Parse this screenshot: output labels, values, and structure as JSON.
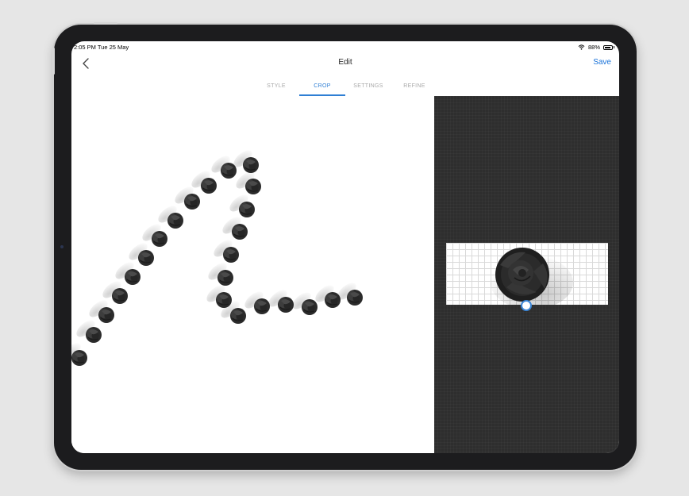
{
  "status_bar": {
    "time_date": "2:05 PM  Tue 25 May",
    "battery": "88%"
  },
  "nav": {
    "title": "Edit",
    "save_label": "Save"
  },
  "tabs": [
    {
      "label": "STYLE"
    },
    {
      "label": "CROP"
    },
    {
      "label": "SETTINGS"
    },
    {
      "label": "REFINE"
    }
  ],
  "active_tab": "CROP",
  "colors": {
    "accent": "#2f7fd4",
    "panel_background": "#2e2e2e",
    "rose": "#2a2a2a"
  },
  "icons": {
    "back": "chevron-left-icon",
    "wifi": "wifi-icon",
    "battery": "battery-icon",
    "brush_stamp": "rose-icon"
  }
}
